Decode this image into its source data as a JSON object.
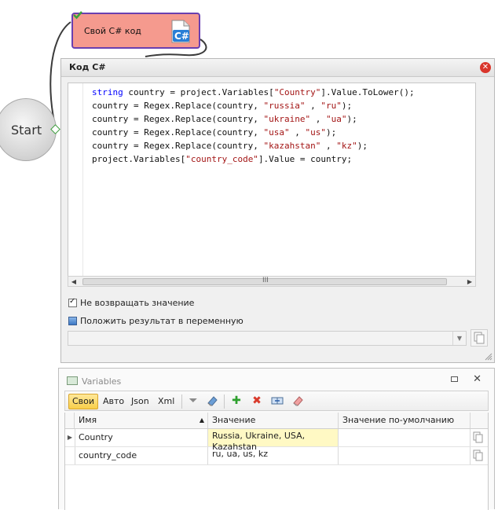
{
  "canvas": {
    "action_block": {
      "title": "Свой C# код",
      "icon": "csharp-file-icon"
    },
    "start_node": {
      "label": "Start"
    }
  },
  "code_window": {
    "title": "Код C#",
    "code_lines": [
      "string country = project.Variables[\"Country\"].Value.ToLower();",
      "country = Regex.Replace(country, \"russia\" , \"ru\");",
      "country = Regex.Replace(country, \"ukraine\" , \"ua\");",
      "country = Regex.Replace(country, \"usa\" , \"us\");",
      "country = Regex.Replace(country, \"kazahstan\" , \"kz\");",
      "project.Variables[\"country_code\"].Value = country;"
    ],
    "scroll_grip": "III",
    "option_no_return": {
      "label": "Не возвращать значение",
      "checked": true
    },
    "option_save_result": {
      "label": "Положить результат в переменную",
      "checked": false
    },
    "result_variable": ""
  },
  "variables_panel": {
    "title": "Variables",
    "tabs": [
      {
        "label": "Свои",
        "active": true
      },
      {
        "label": "Авто",
        "active": false
      },
      {
        "label": "Json",
        "active": false
      },
      {
        "label": "Xml",
        "active": false
      }
    ],
    "tools": [
      "filter-icon",
      "eraser-icon",
      "add-icon",
      "delete-icon",
      "import-export-icon",
      "clear-icon"
    ],
    "columns": {
      "name": "Имя",
      "value": "Значение",
      "default": "Значение по-умолчанию"
    },
    "rows": [
      {
        "name": "Country",
        "value": "Russia, Ukraine, USA, Kazahstan",
        "default": "",
        "highlight": "#fff9c4"
      },
      {
        "name": "country_code",
        "value": "ru, ua, us, kz",
        "default": ""
      }
    ]
  }
}
